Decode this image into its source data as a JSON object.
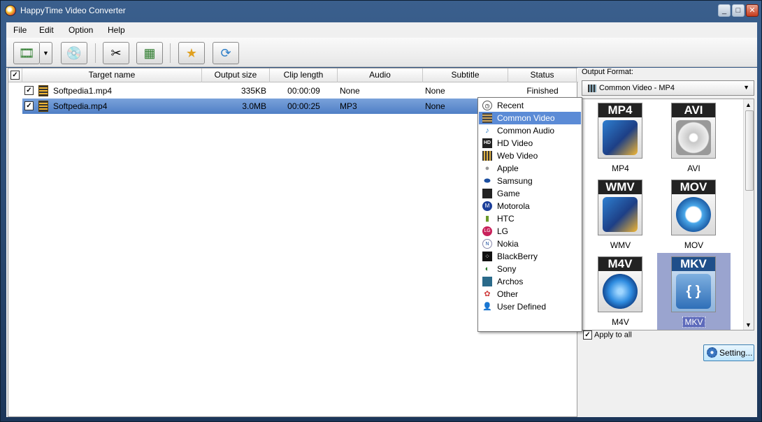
{
  "window": {
    "title": "HappyTime Video Converter"
  },
  "menu": [
    "File",
    "Edit",
    "Option",
    "Help"
  ],
  "toolbar": {
    "buttons": [
      "add-video-icon",
      "add-dvd-icon",
      "cut-icon",
      "effect-icon",
      "output-folder-icon",
      "convert-icon"
    ]
  },
  "table": {
    "columns": [
      "Target name",
      "Output size",
      "Clip length",
      "Audio",
      "Subtitle",
      "Status"
    ],
    "rows": [
      {
        "checked": true,
        "name": "Softpedia1.mp4",
        "size": "335KB",
        "length": "00:00:09",
        "audio": "None",
        "subtitle": "None",
        "status": "Finished",
        "selected": false
      },
      {
        "checked": true,
        "name": "Softpedia.mp4",
        "size": "3.0MB",
        "length": "00:00:25",
        "audio": "MP3",
        "subtitle": "None",
        "status": "",
        "selected": true
      }
    ]
  },
  "output": {
    "label": "Output Format:",
    "selected": "Common Video - MP4",
    "formats": [
      {
        "tag": "MP4",
        "name": "MP4"
      },
      {
        "tag": "AVI",
        "name": "AVI"
      },
      {
        "tag": "WMV",
        "name": "WMV"
      },
      {
        "tag": "MOV",
        "name": "MOV"
      },
      {
        "tag": "M4V",
        "name": "M4V"
      },
      {
        "tag": "MKV",
        "name": "MKV"
      }
    ],
    "apply_all": "Apply to all",
    "setting": "Setting..."
  },
  "category_menu": [
    {
      "label": "Recent",
      "icon": "clock-icon"
    },
    {
      "label": "Common Video",
      "icon": "film-icon"
    },
    {
      "label": "Common Audio",
      "icon": "music-note-icon"
    },
    {
      "label": "HD Video",
      "icon": "hd-icon"
    },
    {
      "label": "Web Video",
      "icon": "web-video-icon"
    },
    {
      "label": "Apple",
      "icon": "apple-icon"
    },
    {
      "label": "Samsung",
      "icon": "samsung-icon"
    },
    {
      "label": "Game",
      "icon": "game-icon"
    },
    {
      "label": "Motorola",
      "icon": "motorola-icon"
    },
    {
      "label": "HTC",
      "icon": "htc-icon"
    },
    {
      "label": "LG",
      "icon": "lg-icon"
    },
    {
      "label": "Nokia",
      "icon": "nokia-icon"
    },
    {
      "label": "BlackBerry",
      "icon": "blackberry-icon"
    },
    {
      "label": "Sony",
      "icon": "sony-icon"
    },
    {
      "label": "Archos",
      "icon": "archos-icon"
    },
    {
      "label": "Other",
      "icon": "other-icon"
    },
    {
      "label": "User Defined",
      "icon": "user-icon"
    }
  ],
  "category_selected": "Common Video"
}
